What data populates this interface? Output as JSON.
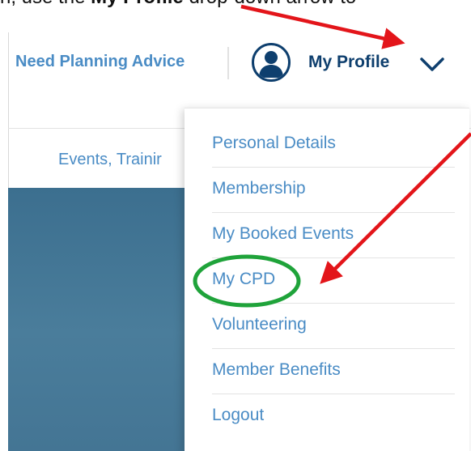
{
  "instruction": {
    "prefix": "n, use the ",
    "bold": "My Profile",
    "suffix": " drop-down arrow to"
  },
  "header": {
    "need_advice": "Need Planning Advice",
    "profile_label": "My Profile",
    "avatar_icon": "user-avatar-icon",
    "chevron_icon": "chevron-down-icon"
  },
  "nav": {
    "events_label": "Events, Trainir"
  },
  "dropdown": {
    "items": [
      {
        "label": "Personal Details"
      },
      {
        "label": "Membership"
      },
      {
        "label": "My Booked Events"
      },
      {
        "label": "My CPD"
      },
      {
        "label": "Volunteering"
      },
      {
        "label": "Member Benefits"
      },
      {
        "label": "Logout"
      }
    ]
  },
  "annotations": {
    "arrow_color": "#e3151a",
    "highlight_color": "#1fa33a"
  },
  "colors": {
    "link": "#4a8cc5",
    "navy": "#0e3f6e",
    "hero": "#3f7394"
  }
}
